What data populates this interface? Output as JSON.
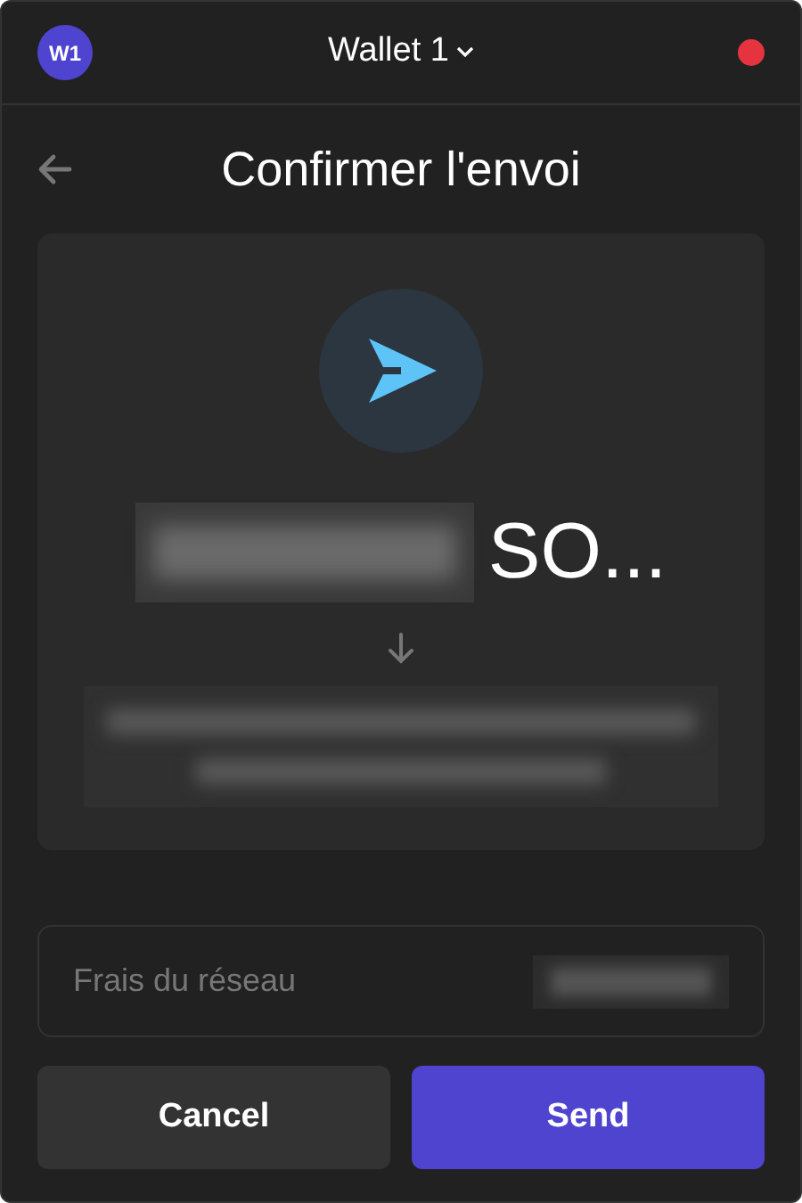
{
  "header": {
    "avatar": "W1",
    "wallet": "Wallet 1",
    "alert": true
  },
  "title": "Confirmer l'envoi",
  "summary": {
    "amount_suffix": "SO..."
  },
  "fee": {
    "label": "Frais du réseau"
  },
  "buttons": [
    {
      "label": "Cancel",
      "kind": "secondary"
    },
    {
      "label": "Send",
      "kind": "primary"
    }
  ]
}
